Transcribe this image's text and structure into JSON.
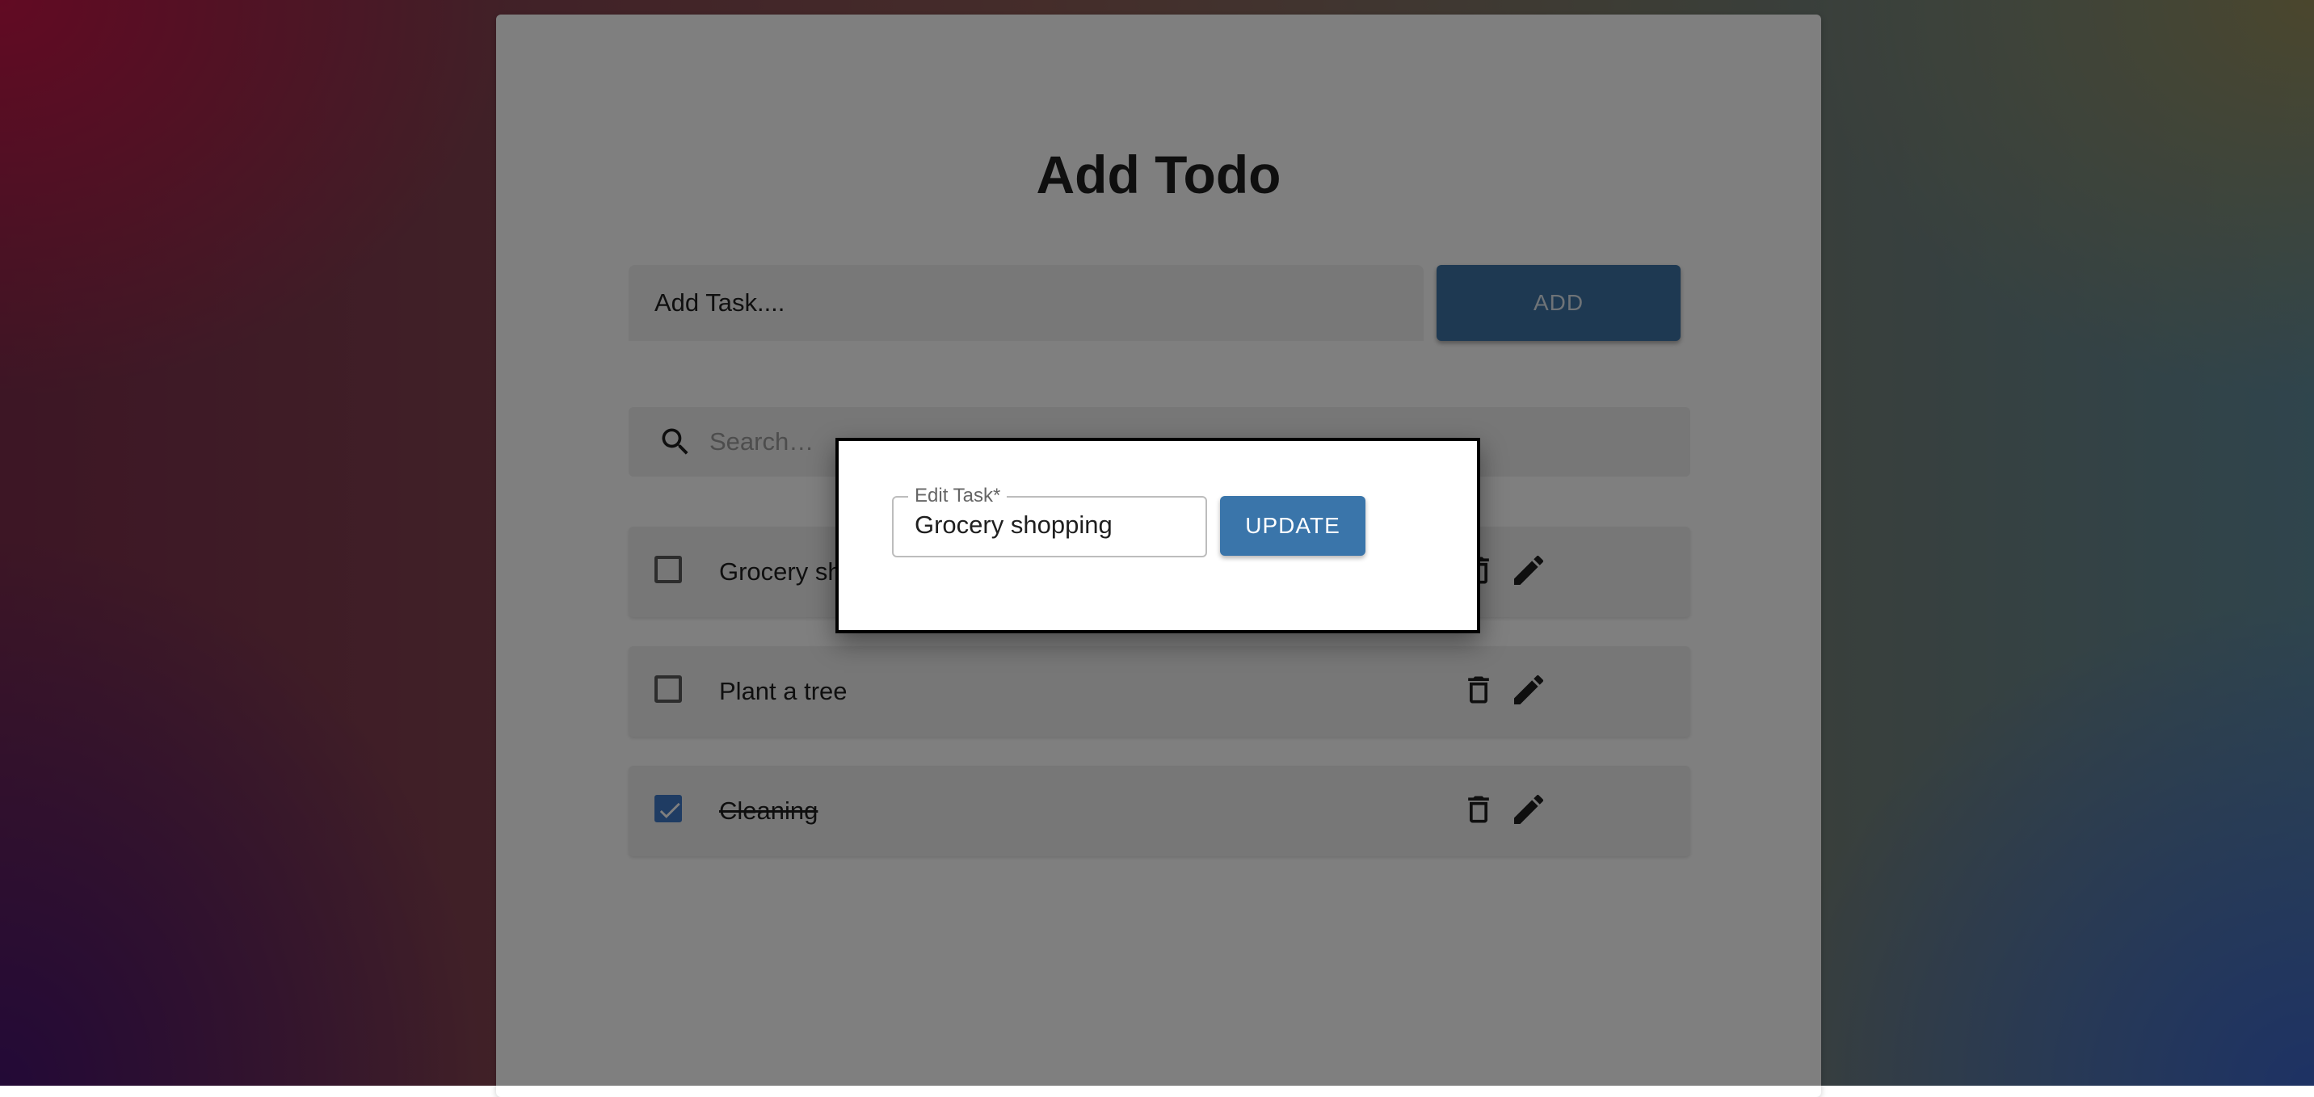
{
  "page": {
    "title": "Add Todo"
  },
  "add_form": {
    "input_value": "Add Task....",
    "add_label": "ADD"
  },
  "search": {
    "placeholder": "Search…"
  },
  "todos": [
    {
      "label": "Grocery shopping",
      "checked": false
    },
    {
      "label": "Plant a tree",
      "checked": false
    },
    {
      "label": "Cleaning",
      "checked": true
    }
  ],
  "dialog": {
    "field_label": "Edit Task",
    "required_marker": "*",
    "field_value": "Grocery shopping",
    "update_label": "UPDATE"
  },
  "icons": {
    "search": "search-icon",
    "delete": "trash-icon",
    "edit": "pencil-icon",
    "check": "checkmark-icon"
  },
  "colors": {
    "primary": "#3c72a4",
    "checkbox_checked": "#3f78c6",
    "overlay": "rgba(0,0,0,0.5)"
  }
}
